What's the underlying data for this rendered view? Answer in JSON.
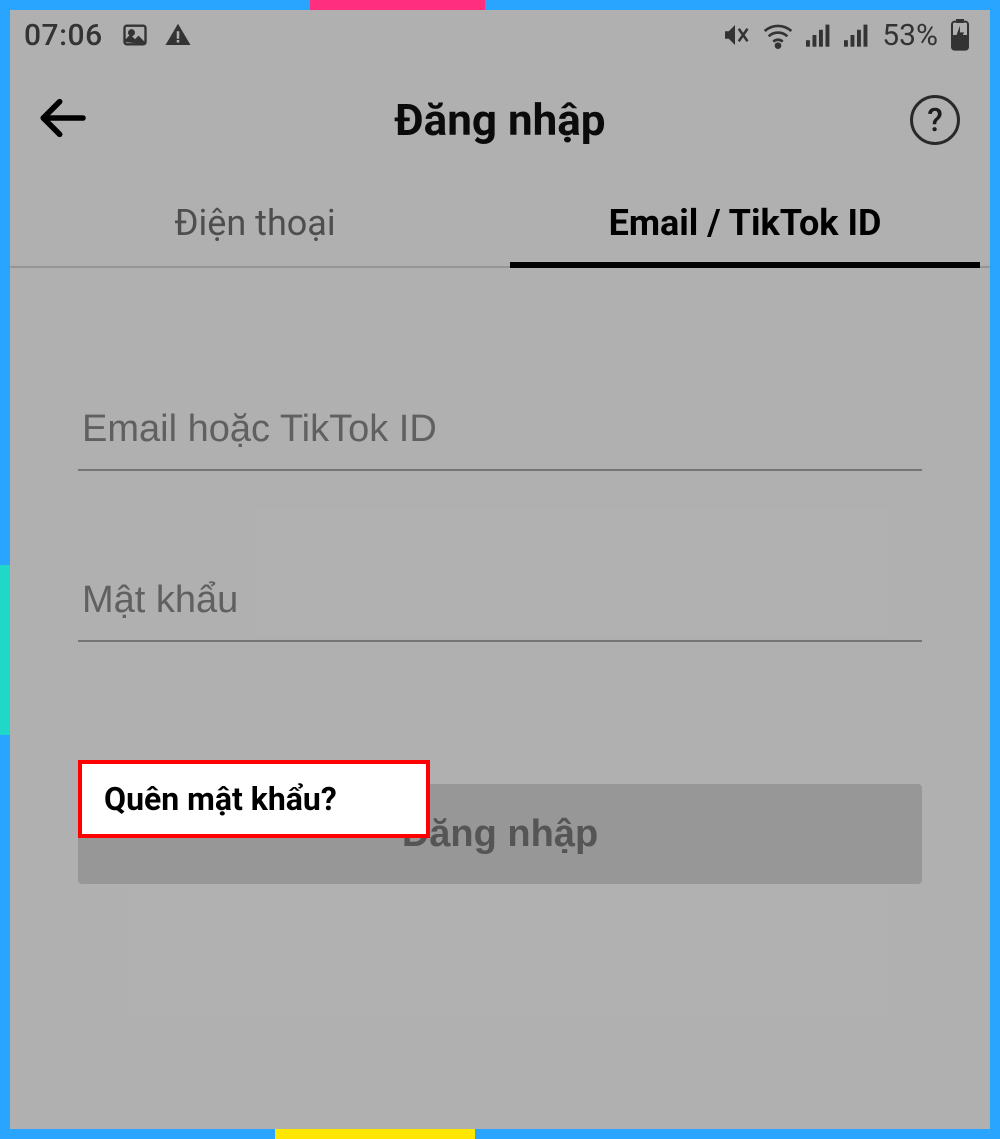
{
  "status_bar": {
    "time": "07:06",
    "battery_text": "53%"
  },
  "header": {
    "title": "Đăng nhập"
  },
  "tabs": {
    "phone": "Điện thoại",
    "email": "Email / TikTok ID"
  },
  "form": {
    "email_placeholder": "Email hoặc TikTok ID",
    "password_placeholder": "Mật khẩu",
    "forgot_password": "Quên mật khẩu?",
    "login_button": "Đăng nhập"
  }
}
